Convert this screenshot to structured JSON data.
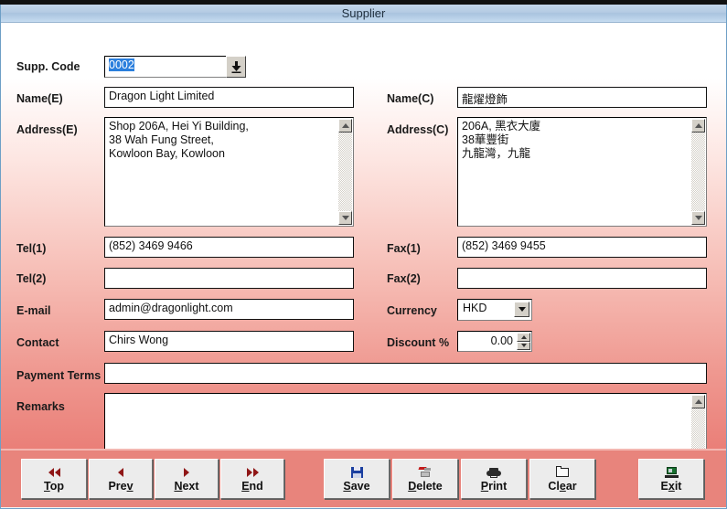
{
  "top_banner": {
    "text": "▪▪ ▪▪▪ ▪▪▪ ▪▪ ▪▪▪▪ ▪▪ ▪▪▪ ▪▪ ▪ ▪▪▪ ▪▪▪▪ ▪▪ ▪▪ ▪▪▪ ▪ ▪▪▪▪ ▪▪"
  },
  "window": {
    "title": "Supplier"
  },
  "form": {
    "supp_code": {
      "label": "Supp. Code",
      "value": "0002",
      "selected": true,
      "dropdown_icon": "down-arrow-bar-icon"
    },
    "name_e": {
      "label": "Name(E)",
      "value": "Dragon Light Limited"
    },
    "name_c": {
      "label": "Name(C)",
      "value": "龍燿燈飾"
    },
    "address_e": {
      "label": "Address(E)",
      "lines": [
        "Shop 206A, Hei Yi Building,",
        "38 Wah Fung Street,",
        "Kowloon Bay, Kowloon"
      ]
    },
    "address_c": {
      "label": "Address(C)",
      "lines": [
        "206A, 黑衣大廈",
        "38華豐街",
        "九龍灣，九龍"
      ]
    },
    "tel1": {
      "label": "Tel(1)",
      "value": "(852) 3469 9466"
    },
    "tel2": {
      "label": "Tel(2)",
      "value": ""
    },
    "fax1": {
      "label": "Fax(1)",
      "value": "(852) 3469 9455"
    },
    "fax2": {
      "label": "Fax(2)",
      "value": ""
    },
    "email": {
      "label": "E-mail",
      "value": "admin@dragonlight.com"
    },
    "currency": {
      "label": "Currency",
      "value": "HKD",
      "options": [
        "HKD"
      ]
    },
    "contact": {
      "label": "Contact",
      "value": "Chirs Wong"
    },
    "discount": {
      "label": "Discount %",
      "value": "0.00"
    },
    "payment_terms": {
      "label": "Payment Terms",
      "value": ""
    },
    "remarks": {
      "label": "Remarks",
      "value": ""
    }
  },
  "toolbar": {
    "buttons": [
      {
        "name": "top",
        "label_pre": "",
        "label_key": "T",
        "label_post": "op",
        "icon": "double-left-arrow-icon"
      },
      {
        "name": "prev",
        "label_pre": "Pre",
        "label_key": "v",
        "label_post": "",
        "icon": "left-arrow-icon"
      },
      {
        "name": "next",
        "label_pre": "",
        "label_key": "N",
        "label_post": "ext",
        "icon": "right-arrow-icon"
      },
      {
        "name": "end",
        "label_pre": "",
        "label_key": "E",
        "label_post": "nd",
        "icon": "double-right-arrow-icon"
      },
      {
        "name": "save",
        "label_pre": "",
        "label_key": "S",
        "label_post": "ave",
        "icon": "floppy-disk-icon"
      },
      {
        "name": "delete",
        "label_pre": "",
        "label_key": "D",
        "label_post": "elete",
        "icon": "delete-icon"
      },
      {
        "name": "print",
        "label_pre": "",
        "label_key": "P",
        "label_post": "rint",
        "icon": "printer-icon"
      },
      {
        "name": "clear",
        "label_pre": "Cl",
        "label_key": "e",
        "label_post": "ar",
        "icon": "blank-page-icon"
      },
      {
        "name": "exit",
        "label_pre": "E",
        "label_key": "x",
        "label_post": "it",
        "icon": "exit-monitor-icon"
      }
    ]
  },
  "colors": {
    "form_top": "#ffffff",
    "form_bottom": "#ea7f78",
    "toolbar_bg": "#e8847c",
    "titlebar": "#b4cbe3",
    "selection": "#2b7fdd",
    "nav_arrow": "#8f1616",
    "floppy": "#1b3fa0"
  }
}
